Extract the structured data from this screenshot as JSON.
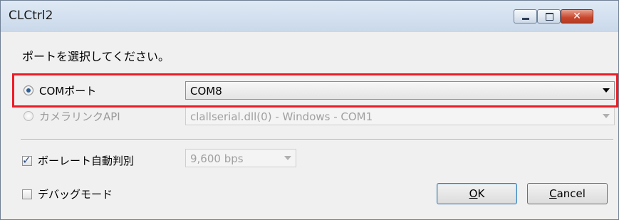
{
  "window": {
    "title": "CLCtrl2",
    "controls": {
      "minimize": "",
      "maximize": "",
      "close": "✕"
    }
  },
  "dialog": {
    "prompt": "ポートを選択してください。",
    "com_port": {
      "label": "COMポート",
      "selected": true,
      "value": "COM8"
    },
    "camera_link": {
      "label": "カメラリンクAPI",
      "selected": false,
      "value": "clallserial.dll(0) - Windows - COM1"
    },
    "auto_baud": {
      "label": "ボーレート自動判別",
      "checked": true,
      "value": "9,600 bps"
    },
    "debug_mode": {
      "label": "デバッグモード",
      "checked": false
    },
    "buttons": {
      "ok_label": "OK",
      "ok_mnemonic": "O",
      "ok_rest": "K",
      "cancel_label": "Cancel",
      "cancel_mnemonic": "C",
      "cancel_rest": "ancel"
    }
  },
  "colors": {
    "highlight": "#ee1c25",
    "title_gradient_top": "#dfe9f5",
    "title_gradient_bottom": "#c9d8ea",
    "close_button": "#c9462c"
  }
}
